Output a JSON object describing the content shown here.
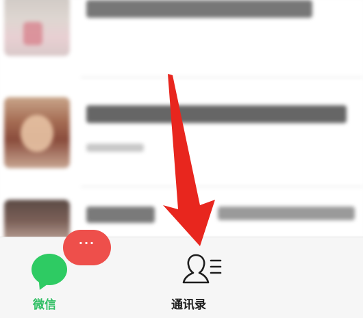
{
  "tab_bar": {
    "tabs": [
      {
        "key": "wechat",
        "label": "微信",
        "icon": "chat-bubble-icon",
        "active": true
      },
      {
        "key": "contacts",
        "label": "通讯录",
        "icon": "contacts-icon",
        "active": false
      }
    ],
    "unread_badge": "···"
  },
  "colors": {
    "active_tab": "#2fbf63",
    "bubble": "#2ecb63",
    "badge": "#ee4f4b",
    "arrow": "#e8261e",
    "inactive_tab": "#1e1e1e"
  }
}
